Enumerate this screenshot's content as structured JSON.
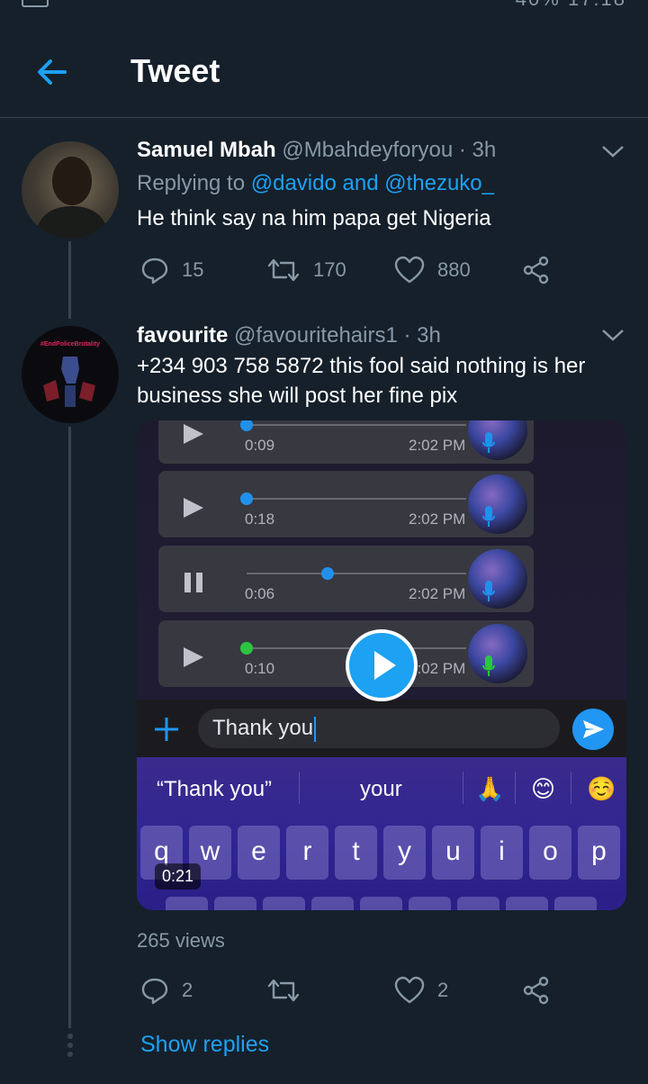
{
  "status_bar": {
    "right": "40%  17:18"
  },
  "header": {
    "title": "Tweet"
  },
  "tweet1": {
    "name": "Samuel Mbah",
    "handle": "@Mbahdeyforyou",
    "time": "· 3h",
    "replying_prefix": "Replying to",
    "replying_to": "@davido and @thezuko_",
    "text": "He think say na him papa get Nigeria",
    "replies": "15",
    "retweets": "170",
    "likes": "880"
  },
  "tweet2": {
    "name": "favourite",
    "handle": "@favouritehairs1",
    "time": "· 3h",
    "text": "+234 903 758 5872 this fool said nothing is her business she will post her fine pix",
    "avatar_label": "#EndPoliceBrutality",
    "media": {
      "voice_notes": [
        {
          "duration": "0:09",
          "time": "2:02 PM",
          "state": "play",
          "progress": 0.0,
          "dot_color": "#2196f3",
          "mic_color": "#2196f3"
        },
        {
          "duration": "0:18",
          "time": "2:02 PM",
          "state": "play",
          "progress": 0.0,
          "dot_color": "#2196f3",
          "mic_color": "#2196f3"
        },
        {
          "duration": "0:06",
          "time": "2:02 PM",
          "state": "pause",
          "progress": 0.37,
          "dot_color": "#2196f3",
          "mic_color": "#2196f3"
        },
        {
          "duration": "0:10",
          "time": "2:02 PM",
          "state": "play",
          "progress": 0.0,
          "dot_color": "#2ecc40",
          "mic_color": "#2ecc40"
        }
      ],
      "chat_input_value": "Thank you",
      "suggestions": [
        "“Thank you”",
        "your"
      ],
      "emojis": [
        "🙏",
        "😊",
        "☺️"
      ],
      "keys": [
        "q",
        "w",
        "e",
        "r",
        "t",
        "y",
        "u",
        "i",
        "o",
        "p"
      ],
      "video_timestamp": "0:21"
    },
    "views": "265 views",
    "replies": "2",
    "likes": "2"
  },
  "show_replies": "Show replies",
  "colors": {
    "background": "#15202b",
    "accent": "#1da1f2",
    "muted": "#8899a6",
    "divider": "#38444d"
  }
}
